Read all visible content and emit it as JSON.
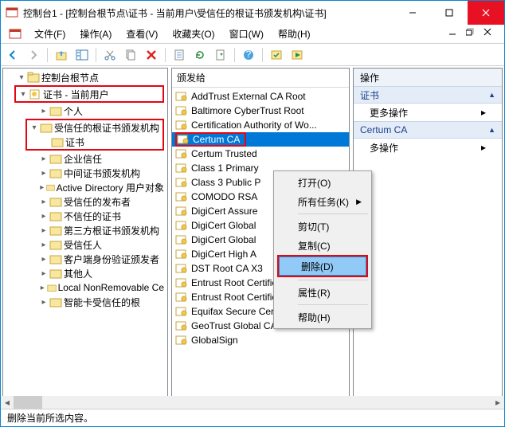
{
  "window": {
    "title": "控制台1 - [控制台根节点\\证书 - 当前用户\\受信任的根证书颁发机构\\证书]"
  },
  "menu": {
    "file": "文件(F)",
    "action": "操作(A)",
    "view": "查看(V)",
    "fav": "收藏夹(O)",
    "window": "窗口(W)",
    "help": "帮助(H)"
  },
  "tree": {
    "root": "控制台根节点",
    "certs_user": "证书 - 当前用户",
    "items": [
      "个人",
      "受信任的根证书颁发机构",
      "证书",
      "企业信任",
      "中间证书颁发机构",
      "Active Directory 用户对象",
      "受信任的发布者",
      "不信任的证书",
      "第三方根证书颁发机构",
      "受信任人",
      "客户端身份验证颁发者",
      "其他人",
      "Local NonRemovable Ce",
      "智能卡受信任的根"
    ]
  },
  "list": {
    "header": "颁发给",
    "rows": [
      "AddTrust External CA Root",
      "Baltimore CyberTrust Root",
      "Certification Authority of Wo...",
      "Certum CA",
      "Certum Trusted",
      "Class 1 Primary",
      "Class 3 Public P",
      "COMODO RSA",
      "DigiCert Assure",
      "DigiCert Global",
      "DigiCert Global",
      "DigiCert High A",
      "DST Root CA X3",
      "Entrust Root Certification Au...",
      "Entrust Root Certification Au...",
      "Equifax Secure Certificate Au...",
      "GeoTrust Global CA",
      "GlobalSign"
    ],
    "selected_index": 3
  },
  "context": {
    "open": "打开(O)",
    "all_tasks": "所有任务(K)",
    "cut": "剪切(T)",
    "copy": "复制(C)",
    "delete": "删除(D)",
    "props": "属性(R)",
    "help": "帮助(H)"
  },
  "actions": {
    "header": "操作",
    "section1": "证书",
    "more1": "更多操作",
    "section2": "Certum CA",
    "more2": "多操作"
  },
  "status": "删除当前所选内容。"
}
